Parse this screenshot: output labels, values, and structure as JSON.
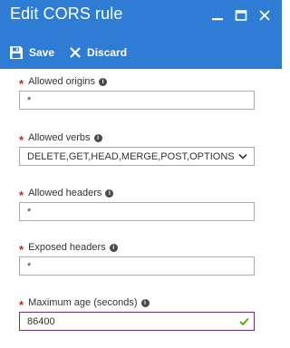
{
  "window": {
    "title": "Edit CORS rule",
    "controls": [
      "minimize-icon",
      "maximize-icon",
      "close-icon"
    ]
  },
  "toolbar": {
    "save_label": "Save",
    "discard_label": "Discard"
  },
  "form": {
    "required_marker": "*",
    "info_glyph": "i",
    "allowed_origins": {
      "label": "Allowed origins",
      "value": "*"
    },
    "allowed_verbs": {
      "label": "Allowed verbs",
      "value": "DELETE,GET,HEAD,MERGE,POST,OPTIONS,PUT"
    },
    "allowed_headers": {
      "label": "Allowed headers",
      "value": "*"
    },
    "exposed_headers": {
      "label": "Exposed headers",
      "value": "*"
    },
    "max_age": {
      "label": "Maximum age (seconds)",
      "value": "86400"
    }
  },
  "colors": {
    "header_bg": "#2f7cd4",
    "required": "#c5242b",
    "valid_check": "#57a300",
    "valid_border": "#6b2d84"
  }
}
